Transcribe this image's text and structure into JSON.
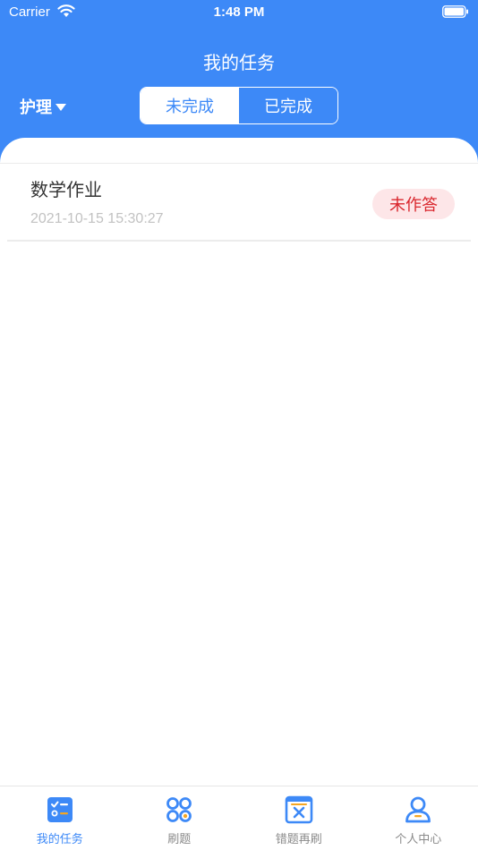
{
  "status_bar": {
    "carrier": "Carrier",
    "time": "1:48 PM"
  },
  "nav": {
    "title": "我的任务"
  },
  "category": {
    "selected": "护理"
  },
  "segments": {
    "incomplete": "未完成",
    "completed": "已完成",
    "active": "incomplete"
  },
  "tasks": [
    {
      "title": "数学作业",
      "time": "2021-10-15 15:30:27",
      "status": "未作答"
    }
  ],
  "tabs": [
    {
      "label": "我的任务",
      "icon": "task-list-icon",
      "active": true
    },
    {
      "label": "刷题",
      "icon": "grid-circles-icon",
      "active": false
    },
    {
      "label": "错题再刷",
      "icon": "wrong-question-icon",
      "active": false
    },
    {
      "label": "个人中心",
      "icon": "user-icon",
      "active": false
    }
  ],
  "colors": {
    "primary": "#3d89f7",
    "badge_bg": "#fde6e8",
    "badge_text": "#d9252c",
    "accent_orange": "#f5a623"
  }
}
